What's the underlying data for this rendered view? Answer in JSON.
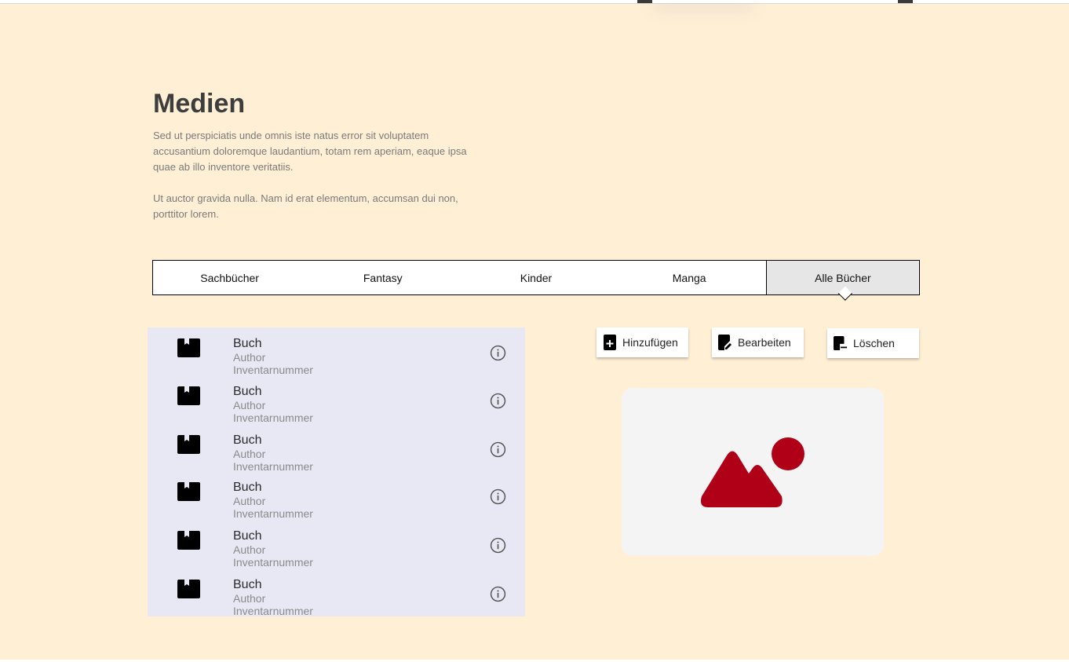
{
  "header": {
    "title": "Medien",
    "description_1": "Sed ut perspiciatis unde omnis iste natus error sit voluptatem accusantium doloremque laudantium, totam rem aperiam, eaque ipsa quae ab illo inventore veritatiis.",
    "description_2": "Ut auctor gravida nulla. Nam id erat elementum, accumsan dui non, porttitor lorem."
  },
  "tabs": [
    {
      "label": "Sachbücher",
      "active": false
    },
    {
      "label": "Fantasy",
      "active": false
    },
    {
      "label": "Kinder",
      "active": false
    },
    {
      "label": "Manga",
      "active": false
    },
    {
      "label": "Alle Bücher",
      "active": true
    }
  ],
  "books": [
    {
      "title": "Buch",
      "author": "Author",
      "inventory": "Inventarnummer"
    },
    {
      "title": "Buch",
      "author": "Author",
      "inventory": "Inventarnummer"
    },
    {
      "title": "Buch",
      "author": "Author",
      "inventory": "Inventarnummer"
    },
    {
      "title": "Buch",
      "author": "Author",
      "inventory": "Inventarnummer"
    },
    {
      "title": "Buch",
      "author": "Author",
      "inventory": "Inventarnummer"
    },
    {
      "title": "Buch",
      "author": "Author",
      "inventory": "Inventarnummer"
    }
  ],
  "actions": {
    "add_label": "Hinzufügen",
    "edit_label": "Bearbeiten",
    "delete_label": "Löschen"
  },
  "icons": {
    "book": "book-icon",
    "info": "info-icon",
    "add": "book-add-icon",
    "edit": "book-edit-icon",
    "delete": "book-remove-icon",
    "preview": "image-placeholder-icon"
  },
  "colors": {
    "background": "#ffefd5",
    "list_background": "#e8e8f4",
    "active_tab": "#e6e6e6",
    "image_accent": "#b00018"
  }
}
